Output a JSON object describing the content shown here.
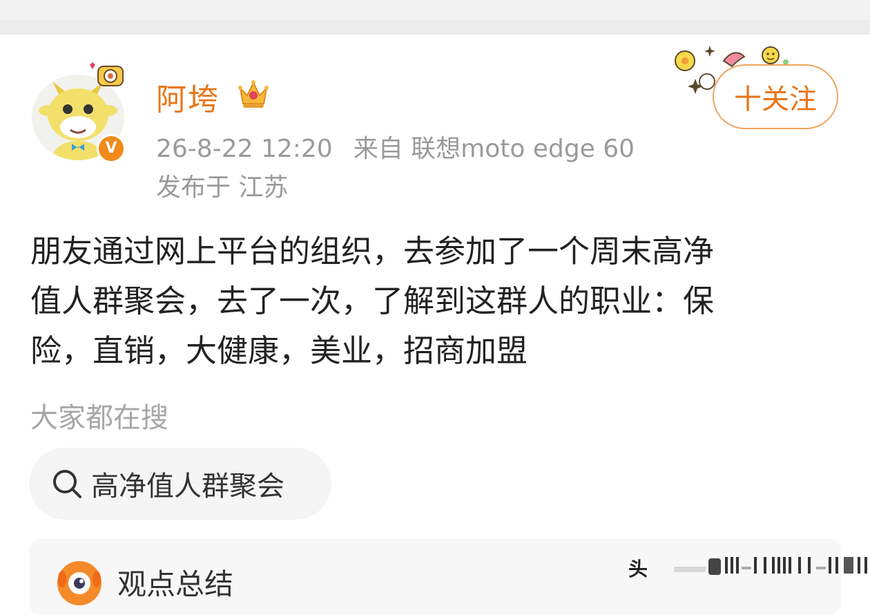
{
  "post": {
    "username": "阿垮",
    "time": "26-8-22 12:20",
    "source": "来自 联想moto edge 60",
    "location": "发布于 江苏",
    "follow_label": "十关注",
    "content_lines": [
      "朋友通过网上平台的组织，去参加了一个周末高净",
      "值人群聚会，去了一次，了解到这群人的职业：保",
      "险，直销，大健康，美业，招商加盟"
    ]
  },
  "hot_search": {
    "label": "大家都在搜",
    "chip_text": "高净值人群聚会"
  },
  "summary_card": {
    "title": "观点总结",
    "watermark": "头"
  },
  "colors": {
    "accent": "#e8761a",
    "meta_text": "#9a9a9a",
    "chip_bg": "#f5f5f5"
  },
  "icons": [
    "verified-badge-icon",
    "crown-icon",
    "search-icon",
    "sticker-decoration",
    "robot-assistant-icon"
  ]
}
